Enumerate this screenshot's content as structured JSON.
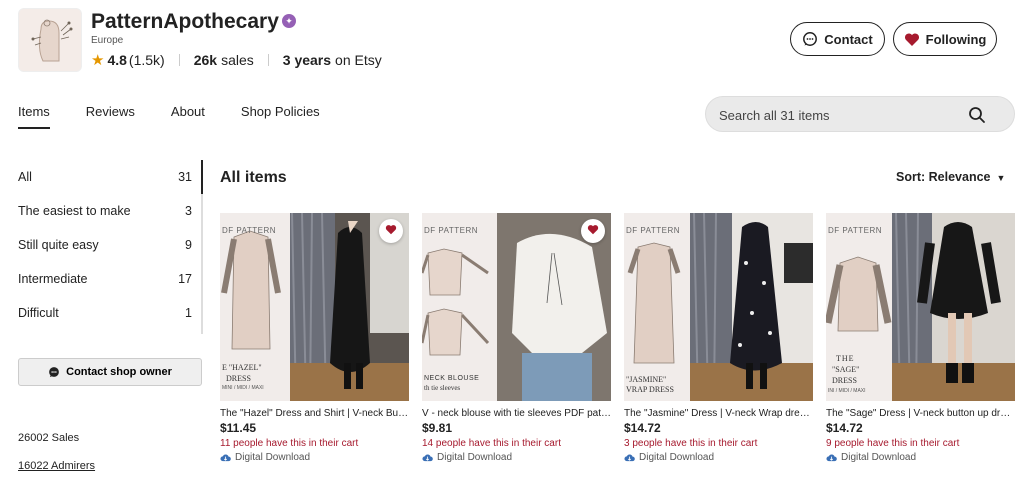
{
  "shop": {
    "name": "PatternApothecary",
    "location": "Europe",
    "rating": "4.8",
    "review_count": "(1.5k)",
    "sales_value": "26k",
    "sales_label": "sales",
    "years_value": "3 years",
    "years_label": "on Etsy"
  },
  "actions": {
    "contact_label": "Contact",
    "following_label": "Following"
  },
  "tabs": [
    {
      "label": "Items"
    },
    {
      "label": "Reviews"
    },
    {
      "label": "About"
    },
    {
      "label": "Shop Policies"
    }
  ],
  "search": {
    "placeholder": "Search all 31 items"
  },
  "sidebar": {
    "categories": [
      {
        "label": "All",
        "count": "31"
      },
      {
        "label": "The easiest to make",
        "count": "3"
      },
      {
        "label": "Still quite easy",
        "count": "9"
      },
      {
        "label": "Intermediate",
        "count": "17"
      },
      {
        "label": "Difficult",
        "count": "1"
      }
    ],
    "contact_owner_label": "Contact shop owner",
    "sales_text": "26002 Sales",
    "admirers_text": "16022 Admirers"
  },
  "listing": {
    "title": "All items",
    "sort_label": "Sort: Relevance"
  },
  "products": [
    {
      "overlay_top": "DF PATTERN",
      "overlay_bottom": "E \"HAZEL\"",
      "overlay_bottom2": "DRESS",
      "overlay_bottom3": "MINI / MIDI / MAXI",
      "title": "The \"Hazel\" Dress and Shirt | V-neck Button up Dress PDF Sewing Pattern",
      "price": "$11.45",
      "cart_text": "11 people have this in their cart",
      "download_text": "Digital Download"
    },
    {
      "overlay_top": "DF PATTERN",
      "overlay_bottom": "NECK BLOUSE",
      "overlay_bottom2": "th tie sleeves",
      "overlay_bottom3": "",
      "title": "V - neck blouse with tie sleeves PDF pattern",
      "price": "$9.81",
      "cart_text": "14 people have this in their cart",
      "download_text": "Digital Download"
    },
    {
      "overlay_top": "DF PATTERN",
      "overlay_bottom": "\"JASMINE\"",
      "overlay_bottom2": "VRAP DRESS",
      "overlay_bottom3": "",
      "title": "The \"Jasmine\" Dress | V-neck Wrap dress PDF Sewing Pattern",
      "price": "$14.72",
      "cart_text": "3 people have this in their cart",
      "download_text": "Digital Download"
    },
    {
      "overlay_top": "DF PATTERN",
      "overlay_bottom": "THE",
      "overlay_bottom2": "\"SAGE\"",
      "overlay_bottom3": "DRESS",
      "overlay_bottom4": "INI / MIDI / MAXI",
      "title": "The \"Sage\" Dress | V-neck button up dress PDF Sewing Pattern",
      "price": "$14.72",
      "cart_text": "9 people have this in their cart",
      "download_text": "Digital Download"
    }
  ],
  "colors": {
    "accent_red": "#a61a2e",
    "star_seller": "#9560b5",
    "rating_star": "#e59700",
    "heart": "#a61a2e"
  },
  "icons": [
    "message-icon",
    "heart-icon",
    "search-icon",
    "chevron-down-icon",
    "cloud-download-icon",
    "star-icon",
    "star-seller-badge-icon"
  ]
}
